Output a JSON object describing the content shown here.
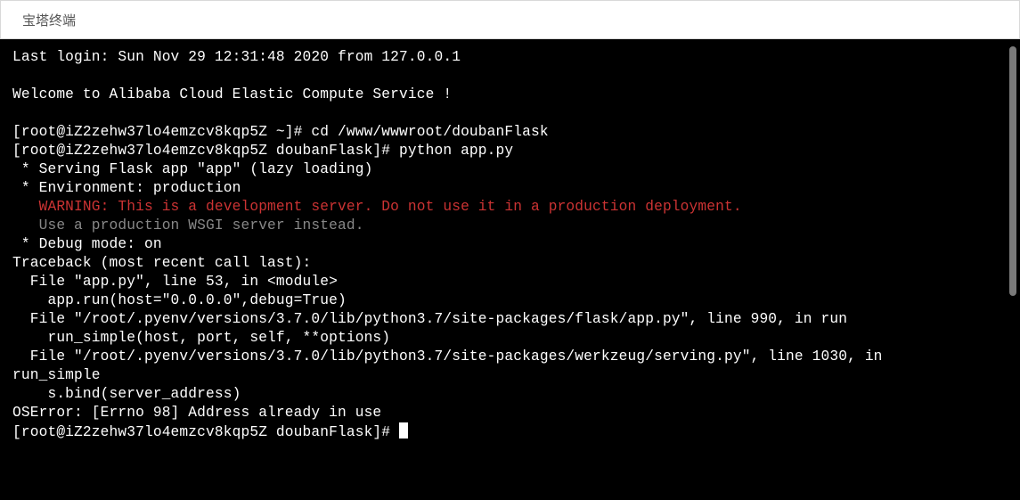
{
  "header": {
    "title": "宝塔终端"
  },
  "term": {
    "last_login": "Last login: Sun Nov 29 12:31:48 2020 from 127.0.0.1",
    "blank1": "",
    "welcome": "Welcome to Alibaba Cloud Elastic Compute Service !",
    "blank2": "",
    "cmd1": "[root@iZ2zehw37lo4emzcv8kqp5Z ~]# cd /www/wwwroot/doubanFlask",
    "cmd2": "[root@iZ2zehw37lo4emzcv8kqp5Z doubanFlask]# python app.py",
    "serve": " * Serving Flask app \"app\" (lazy loading)",
    "env": " * Environment: production",
    "warn": "   WARNING: This is a development server. Do not use it in a production deployment.",
    "hint": "   Use a production WSGI server instead.",
    "debug": " * Debug mode: on",
    "tb": "Traceback (most recent call last):",
    "f1": "  File \"app.py\", line 53, in <module>",
    "f1b": "    app.run(host=\"0.0.0.0\",debug=True)",
    "f2": "  File \"/root/.pyenv/versions/3.7.0/lib/python3.7/site-packages/flask/app.py\", line 990, in run",
    "f2b": "    run_simple(host, port, self, **options)",
    "f3": "  File \"/root/.pyenv/versions/3.7.0/lib/python3.7/site-packages/werkzeug/serving.py\", line 1030, in ",
    "f3w": "run_simple",
    "f3b": "    s.bind(server_address)",
    "err": "OSError: [Errno 98] Address already in use",
    "prompt": "[root@iZ2zehw37lo4emzcv8kqp5Z doubanFlask]# "
  }
}
